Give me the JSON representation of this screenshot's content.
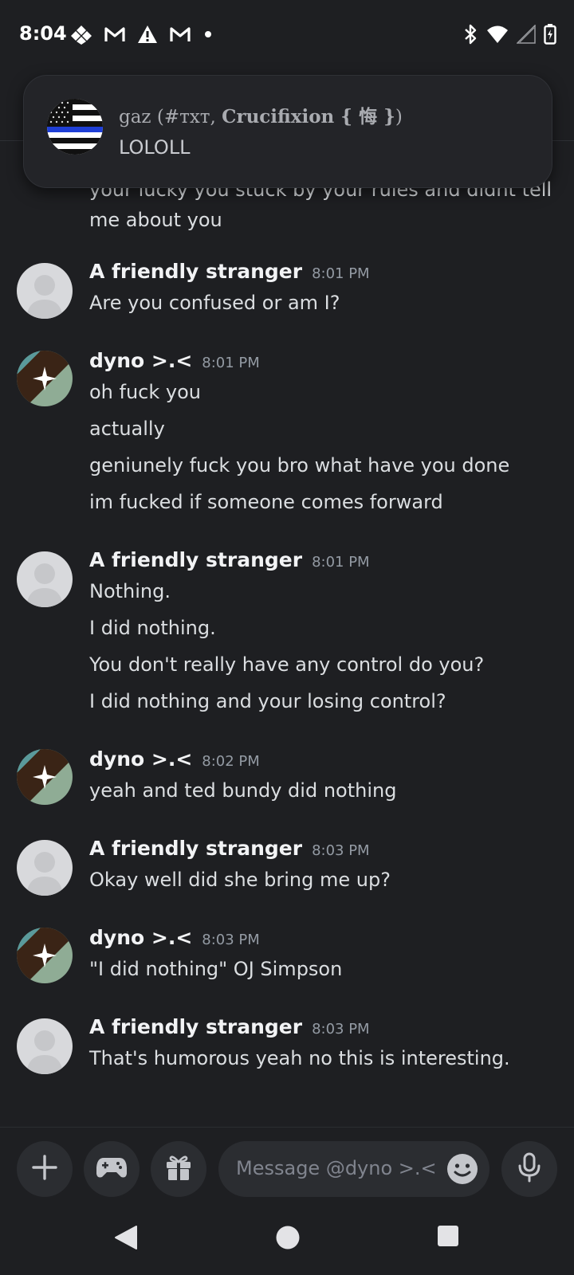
{
  "status_bar": {
    "time": "8:04",
    "left_icons": [
      "tidal-icon",
      "gmail-icon",
      "warning-icon",
      "gmail-icon",
      "dot-icon"
    ],
    "right_icons": [
      "bluetooth-icon",
      "wifi-icon",
      "signal-icon",
      "battery-charging-icon"
    ]
  },
  "notification": {
    "title_prefix": "gaz (#тхт, ",
    "title_bold": "Crucifixion { 悔 }",
    "title_suffix": ")",
    "body": "LOLOLL"
  },
  "messages": [
    {
      "author": "",
      "time": "",
      "lines": [
        "your lucky you stuck by your rules and didnt tell",
        "me about you"
      ]
    },
    {
      "author": "A friendly stranger",
      "time": "8:01 PM",
      "lines": [
        "Are you confused or am I?"
      ]
    },
    {
      "author": "dyno >.<",
      "time": "8:01 PM",
      "lines": [
        "oh fuck you",
        "actually",
        "geniunely fuck you bro what have you done",
        "im fucked if someone comes forward"
      ]
    },
    {
      "author": "A friendly stranger",
      "time": "8:01 PM",
      "lines": [
        "Nothing.",
        "I did nothing.",
        "You don't really have any control do you?",
        "I did nothing and your losing control?"
      ]
    },
    {
      "author": "dyno >.<",
      "time": "8:02 PM",
      "lines": [
        "yeah and ted bundy did nothing"
      ]
    },
    {
      "author": "A friendly stranger",
      "time": "8:03 PM",
      "lines": [
        "Okay well did she bring me up?"
      ]
    },
    {
      "author": "dyno >.<",
      "time": "8:03 PM",
      "lines": [
        "\"I did nothing\" OJ Simpson"
      ]
    },
    {
      "author": "A friendly stranger",
      "time": "8:03 PM",
      "lines": [
        "That's humorous yeah no this is interesting."
      ]
    }
  ],
  "composer": {
    "placeholder": "Message @dyno >.<",
    "buttons": [
      "plus-icon",
      "gamepad-icon",
      "gift-icon",
      "emoji-icon",
      "microphone-icon"
    ]
  },
  "navbar": {
    "buttons": [
      "back-icon",
      "home-icon",
      "recents-icon"
    ]
  },
  "colors": {
    "background": "#1e1f22",
    "input_background": "#2b2d31",
    "text": "#dbdee1",
    "timestamp": "#949ba4"
  }
}
